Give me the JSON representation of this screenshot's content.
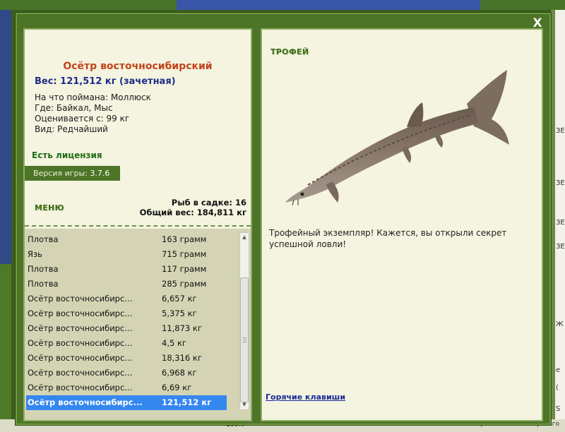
{
  "dialog": {
    "close_icon": "x-close-icon",
    "close_label": "X"
  },
  "fish": {
    "name": "Осётр восточносибирский",
    "weight": "Вес: 121,512 кг (зачетная)",
    "bait": "На что поймана: Моллюск",
    "location": "Где: Байкал, Мыс",
    "value": "Оценивается с: 99 кг",
    "rarity": "Вид: Редчайший"
  },
  "license": "Есть лицензия",
  "version": {
    "label": "Версия игры: ",
    "value": "3.7.6"
  },
  "menu_label": "МЕНЮ",
  "keep_net": {
    "count": "Рыб в садке: 16",
    "total_weight": "Общий вес: 184,811 кг"
  },
  "catch_list": [
    {
      "name": "Плотва",
      "weight": "163 грамм"
    },
    {
      "name": "Язь",
      "weight": "715 грамм"
    },
    {
      "name": "Плотва",
      "weight": "117 грамм"
    },
    {
      "name": "Плотва",
      "weight": "285 грамм"
    },
    {
      "name": "Осётр восточносибирс...",
      "weight": "6,657 кг"
    },
    {
      "name": "Осётр восточносибирс...",
      "weight": "5,375 кг"
    },
    {
      "name": "Осётр восточносибирс...",
      "weight": "11,873 кг"
    },
    {
      "name": "Осётр восточносибирс...",
      "weight": "4,5 кг"
    },
    {
      "name": "Осётр восточносибирс...",
      "weight": "18,316 кг"
    },
    {
      "name": "Осётр восточносибирс...",
      "weight": "6,968 кг"
    },
    {
      "name": "Осётр восточносибирс...",
      "weight": "6,69 кг"
    },
    {
      "name": "Осётр восточносибирс...",
      "weight": "121,512 кг",
      "selected": true
    }
  ],
  "trophy": {
    "title": "ТРОФЕЙ",
    "image_icon": "sturgeon-image",
    "text": "Трофейный экземпляр! Кажется, вы открыли секрет успешной ловли!"
  },
  "hotkeys_link": "Горячие клавиши",
  "background": {
    "bottom_text": "NICOLAY1948 поймал Осетра восточносибирского",
    "bottom_percent": "100%",
    "right_fragments": [
      "ЗЕ",
      "ЗЕ",
      "ЗЕ",
      "ЗЕ",
      "Ж",
      "e",
      "(",
      "S"
    ]
  },
  "colors": {
    "frame_green": "#4d7427",
    "panel_bg": "#f4f4e0",
    "list_bg": "#d4d4b4",
    "selection_blue": "#3587f0",
    "fish_name": "#c3441a",
    "weight_blue": "#1d2d86",
    "license_green": "#1e6e16"
  }
}
